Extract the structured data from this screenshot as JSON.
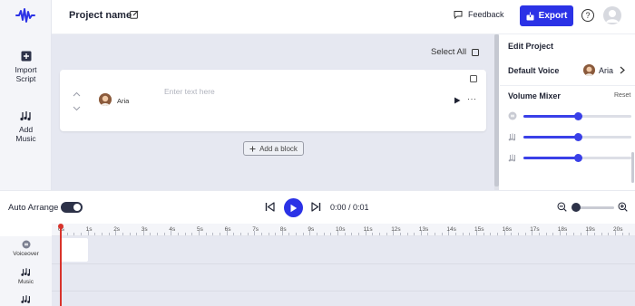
{
  "header": {
    "project_name": "Project name",
    "feedback_label": "Feedback",
    "export_label": "Export",
    "help_label": "?"
  },
  "left_rail": {
    "items": [
      {
        "label_line1": "Import",
        "label_line2": "Script",
        "icon": "plus-square-icon"
      },
      {
        "label_line1": "Add",
        "label_line2": "Music",
        "icon": "music-notes-icon"
      }
    ]
  },
  "editor": {
    "select_all_label": "Select All",
    "blocks": [
      {
        "speaker": "Aria",
        "placeholder": "Enter text here",
        "more_label": "···"
      }
    ],
    "add_block_label": "Add a block"
  },
  "right_panel": {
    "title": "Edit Project",
    "default_voice_label": "Default Voice",
    "default_voice_name": "Aria",
    "volume_mixer_label": "Volume Mixer",
    "reset_label": "Reset",
    "mixer": [
      {
        "icon": "voiceover-icon",
        "level": 0.5
      },
      {
        "icon": "music-notes-icon",
        "level": 0.5
      },
      {
        "icon": "music-notes-icon",
        "level": 0.5
      }
    ]
  },
  "transport": {
    "auto_arrange_label": "Auto Arrange",
    "auto_arrange_on": true,
    "time_display": "0:00 / 0:01"
  },
  "timeline": {
    "ticks": [
      "0s",
      "1s",
      "2s",
      "3s",
      "4s",
      "5s",
      "6s",
      "7s",
      "8s",
      "9s",
      "10s",
      "11s",
      "12s",
      "13s",
      "14s",
      "15s",
      "16s",
      "17s",
      "18s",
      "19s",
      "20s"
    ],
    "tracks": [
      {
        "label": "Voiceover",
        "icon": "voiceover-icon"
      },
      {
        "label": "Music",
        "icon": "music-notes-icon"
      },
      {
        "label": "",
        "icon": "music-notes-icon"
      }
    ]
  },
  "colors": {
    "accent": "#2b32e6",
    "editor_bg": "#e6e8f1",
    "playhead": "#d8332b"
  }
}
